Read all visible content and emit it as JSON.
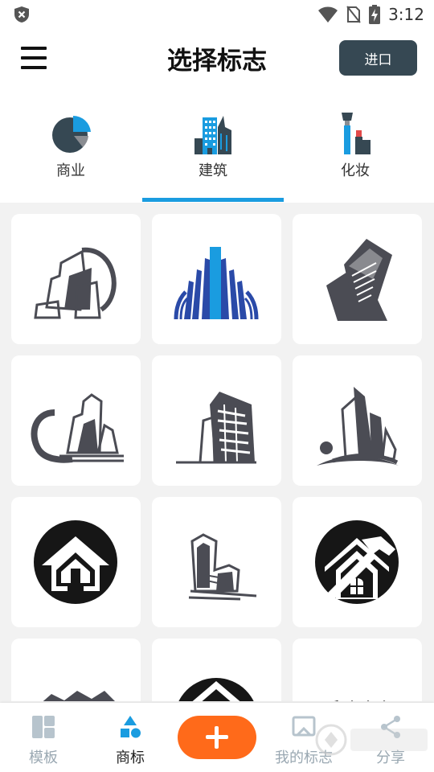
{
  "status_bar": {
    "time": "3:12"
  },
  "header": {
    "title": "选择标志",
    "import_label": "进口"
  },
  "tabs": [
    {
      "label": "商业",
      "icon": "pie-chart-icon"
    },
    {
      "label": "建筑",
      "icon": "buildings-icon",
      "selected": true
    },
    {
      "label": "化妆",
      "icon": "cosmetics-icon"
    }
  ],
  "logos": [
    {
      "icon": "building-logo-1"
    },
    {
      "icon": "building-logo-2"
    },
    {
      "icon": "building-logo-3"
    },
    {
      "icon": "building-logo-4"
    },
    {
      "icon": "building-logo-5"
    },
    {
      "icon": "building-logo-6"
    },
    {
      "icon": "house-circle-logo"
    },
    {
      "icon": "building-logo-8"
    },
    {
      "icon": "house-hammer-logo"
    },
    {
      "icon": "roof-logo-partial"
    },
    {
      "icon": "house-roof-logo-partial"
    },
    {
      "icon": "skyline-logo-partial"
    }
  ],
  "bottom_nav": {
    "templates": "模板",
    "logos": "商标",
    "my_logos": "我的标志",
    "share": "分享"
  },
  "colors": {
    "accent": "#1a9ce0",
    "dark_button": "#364853",
    "add_button": "#ff6a1a",
    "icon_dark": "#4b4c54"
  }
}
